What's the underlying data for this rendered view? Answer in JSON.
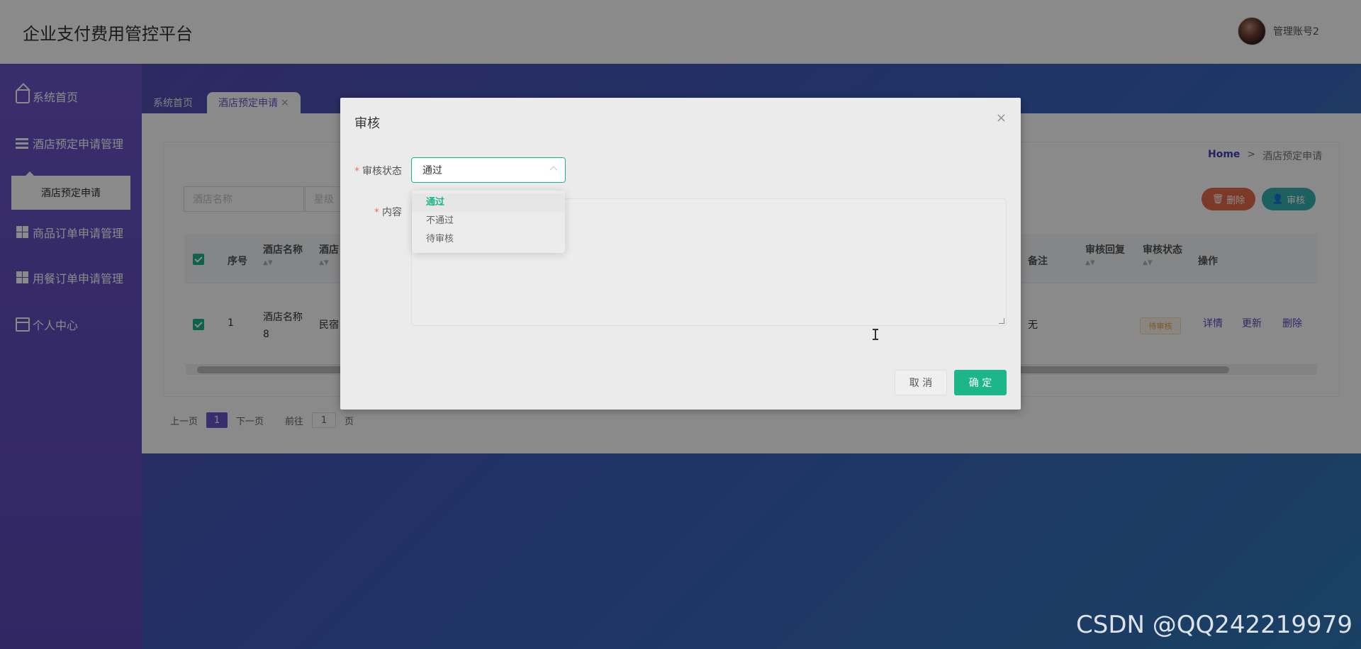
{
  "app": {
    "title": "企业支付费用管控平台",
    "user_name": "管理账号2"
  },
  "sidebar": {
    "items": [
      {
        "label": "系统首页",
        "icon": "home-icon"
      },
      {
        "label": "酒店预定申请管理",
        "icon": "list-icon"
      },
      {
        "label": "商品订单申请管理",
        "icon": "grid-icon"
      },
      {
        "label": "用餐订单申请管理",
        "icon": "grid-icon"
      },
      {
        "label": "个人中心",
        "icon": "card-icon"
      }
    ],
    "submenu_label": "酒店预定申请"
  },
  "tabs": [
    {
      "label": "系统首页"
    },
    {
      "label": "酒店预定申请"
    }
  ],
  "tab_close": "×",
  "breadcrumb": {
    "home": "Home",
    "sep": ">",
    "current": "酒店预定申请"
  },
  "search": {
    "hotel_name_placeholder": "酒店名称",
    "level_placeholder": "星级"
  },
  "actions": {
    "delete_label": "删除",
    "audit_label": "审核"
  },
  "table": {
    "headers": {
      "index": "序号",
      "hotel_name": "酒店名称",
      "hotel_type": "酒店",
      "remark": "备注",
      "audit_reply": "审核回复",
      "audit_status": "审核状态",
      "ops": "操作"
    },
    "row": {
      "index": "1",
      "hotel_name": "酒店名称8",
      "hotel_type": "民宿",
      "remark": "无",
      "audit_status": "待审核",
      "ops": {
        "detail": "详情",
        "update": "更新",
        "delete": "删除"
      }
    }
  },
  "pager": {
    "prev": "上一页",
    "current": "1",
    "next": "下一页",
    "goto": "前往",
    "page_input": "1",
    "page_suffix": "页"
  },
  "modal": {
    "title": "审核",
    "status_label": "审核状态",
    "content_label": "内容",
    "required_mark": "*",
    "selected_value": "通过",
    "options": [
      "通过",
      "不通过",
      "待审核"
    ],
    "cancel_label": "取 消",
    "confirm_label": "确 定",
    "close": "×"
  },
  "watermark": "CSDN @QQ242219979",
  "colors": {
    "primary": "#1db58a",
    "brand_purple": "#6a55c7",
    "danger": "#e86a49",
    "teal": "#35b4b1"
  }
}
